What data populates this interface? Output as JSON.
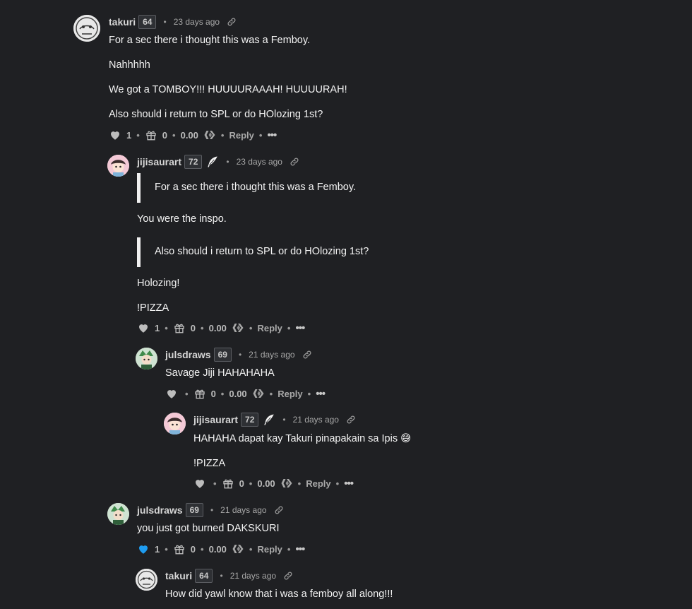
{
  "comments": [
    {
      "username": "takuri",
      "reputation": "64",
      "time": "23 days ago",
      "paragraphs": [
        "For a sec there i thought this was a Femboy.",
        "Nahhhhh",
        "We got a TOMBOY!!! HUUUURAAAH! HUUUURAH!",
        "Also should i return to SPL or do HOlozing 1st?"
      ],
      "likes": "1",
      "gifts": "0",
      "payout": "0.00",
      "reply": "Reply",
      "more": "•••",
      "liked": false
    },
    {
      "username": "jijisaurart",
      "reputation": "72",
      "time": "23 days ago",
      "quote1": "For a sec there i thought this was a Femboy.",
      "text1": "You were the inspo.",
      "quote2": "Also should i return to SPL or do HOlozing 1st?",
      "text2": "Holozing!",
      "text3": "!PIZZA",
      "likes": "1",
      "gifts": "0",
      "payout": "0.00",
      "reply": "Reply",
      "more": "•••",
      "liked": false
    },
    {
      "username": "julsdraws",
      "reputation": "69",
      "time": "21 days ago",
      "text1": "Savage Jiji HAHAHAHA",
      "likes": "",
      "gifts": "0",
      "payout": "0.00",
      "reply": "Reply",
      "more": "•••",
      "liked": false
    },
    {
      "username": "jijisaurart",
      "reputation": "72",
      "time": "21 days ago",
      "text1": "HAHAHA dapat kay Takuri pinapakain sa Ipis 😅",
      "text2": "!PIZZA",
      "likes": "",
      "gifts": "0",
      "payout": "0.00",
      "reply": "Reply",
      "more": "•••",
      "liked": false
    },
    {
      "username": "julsdraws",
      "reputation": "69",
      "time": "21 days ago",
      "text1": "you just got burned DAKSKURI",
      "likes": "1",
      "gifts": "0",
      "payout": "0.00",
      "reply": "Reply",
      "more": "•••",
      "liked": true
    },
    {
      "username": "takuri",
      "reputation": "64",
      "time": "21 days ago",
      "text1": "How did yawl know that i was a femboy all along!!!"
    }
  ],
  "colors": {
    "background": "#1f2023",
    "liked": "#1e9cf0",
    "heart": "#bdbdbd"
  }
}
